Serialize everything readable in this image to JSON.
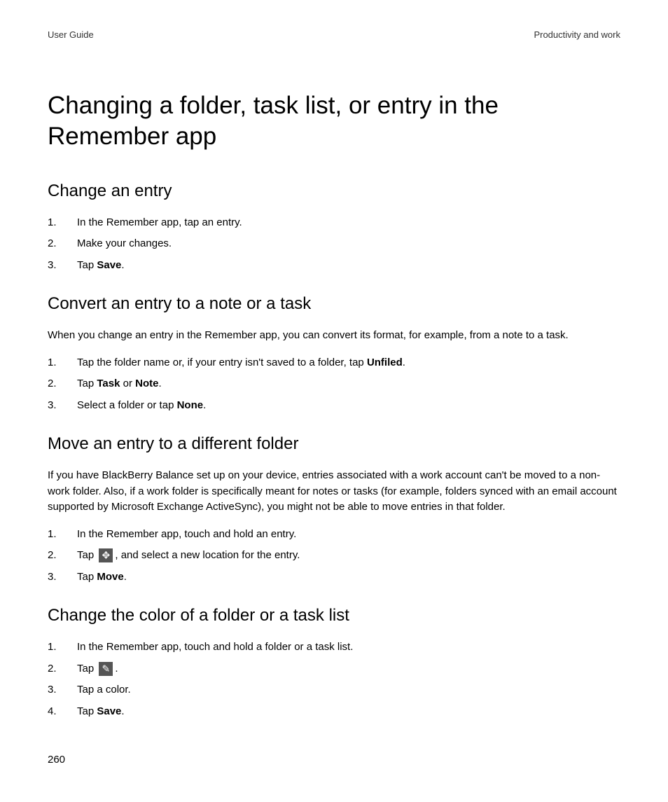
{
  "header": {
    "left": "User Guide",
    "right": "Productivity and work"
  },
  "title": "Changing a folder, task list, or entry in the Remember app",
  "sections": [
    {
      "heading": "Change an entry",
      "intro": "",
      "steps": [
        {
          "text": "In the Remember app, tap an entry."
        },
        {
          "text": "Make your changes."
        },
        {
          "prefix": "Tap ",
          "bold": "Save",
          "suffix": "."
        }
      ]
    },
    {
      "heading": "Convert an entry to a note or a task",
      "intro": "When you change an entry in the Remember app, you can convert its format, for example, from a note to a task.",
      "steps": [
        {
          "prefix": "Tap the folder name or, if your entry isn't saved to a folder, tap ",
          "bold": "Unfiled",
          "suffix": "."
        },
        {
          "prefix": "Tap ",
          "bold": "Task",
          "mid": " or ",
          "bold2": "Note",
          "suffix": "."
        },
        {
          "prefix": "Select a folder or tap ",
          "bold": "None",
          "suffix": "."
        }
      ]
    },
    {
      "heading": "Move an entry to a different folder",
      "intro": "If you have BlackBerry Balance set up on your device, entries associated with a work account can't be moved to a non-work folder. Also, if a work folder is specifically meant for notes or tasks (for example, folders synced with an email account supported by Microsoft Exchange ActiveSync), you might not be able to move entries in that folder.",
      "steps": [
        {
          "text": "In the Remember app, touch and hold an entry."
        },
        {
          "prefix": "Tap ",
          "icon": "move",
          "suffix": ", and select a new location for the entry."
        },
        {
          "prefix": "Tap ",
          "bold": "Move",
          "suffix": "."
        }
      ]
    },
    {
      "heading": "Change the color of a folder or a task list",
      "intro": "",
      "steps": [
        {
          "text": "In the Remember app, touch and hold a folder or a task list."
        },
        {
          "prefix": "Tap ",
          "icon": "edit",
          "suffix": "."
        },
        {
          "text": "Tap a color."
        },
        {
          "prefix": "Tap ",
          "bold": "Save",
          "suffix": "."
        }
      ]
    }
  ],
  "pageNumber": "260"
}
